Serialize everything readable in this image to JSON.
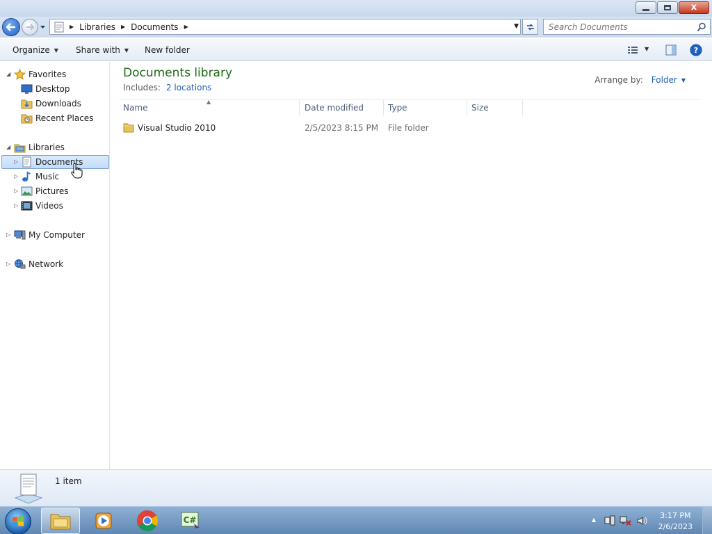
{
  "window": {
    "controls": {
      "minimize": "minimize",
      "maximize": "maximize",
      "close": "x"
    }
  },
  "address_bar": {
    "breadcrumbs": [
      "Libraries",
      "Documents"
    ],
    "search_placeholder": "Search Documents"
  },
  "toolbar": {
    "organize": "Organize",
    "share_with": "Share with",
    "new_folder": "New folder"
  },
  "nav": {
    "favorites": "Favorites",
    "desktop": "Desktop",
    "downloads": "Downloads",
    "recent_places": "Recent Places",
    "libraries": "Libraries",
    "documents": "Documents",
    "music": "Music",
    "pictures": "Pictures",
    "videos": "Videos",
    "my_computer": "My Computer",
    "network": "Network"
  },
  "content": {
    "title": "Documents library",
    "includes_label": "Includes:",
    "includes_link": "2 locations",
    "arrange_label": "Arrange by:",
    "arrange_value": "Folder",
    "columns": [
      "Name",
      "Date modified",
      "Type",
      "Size"
    ],
    "rows": [
      {
        "name": "Visual Studio 2010",
        "date": "2/5/2023 8:15 PM",
        "type": "File folder",
        "size": ""
      }
    ]
  },
  "details": {
    "count": "1 item"
  },
  "taskbar": {
    "time": "3:17 PM",
    "date": "2/6/2023",
    "csharp_label": "C#"
  },
  "colors": {
    "title_green": "#1e6b16",
    "link_blue": "#1a5fb4",
    "selection": "#c1dcfc"
  }
}
